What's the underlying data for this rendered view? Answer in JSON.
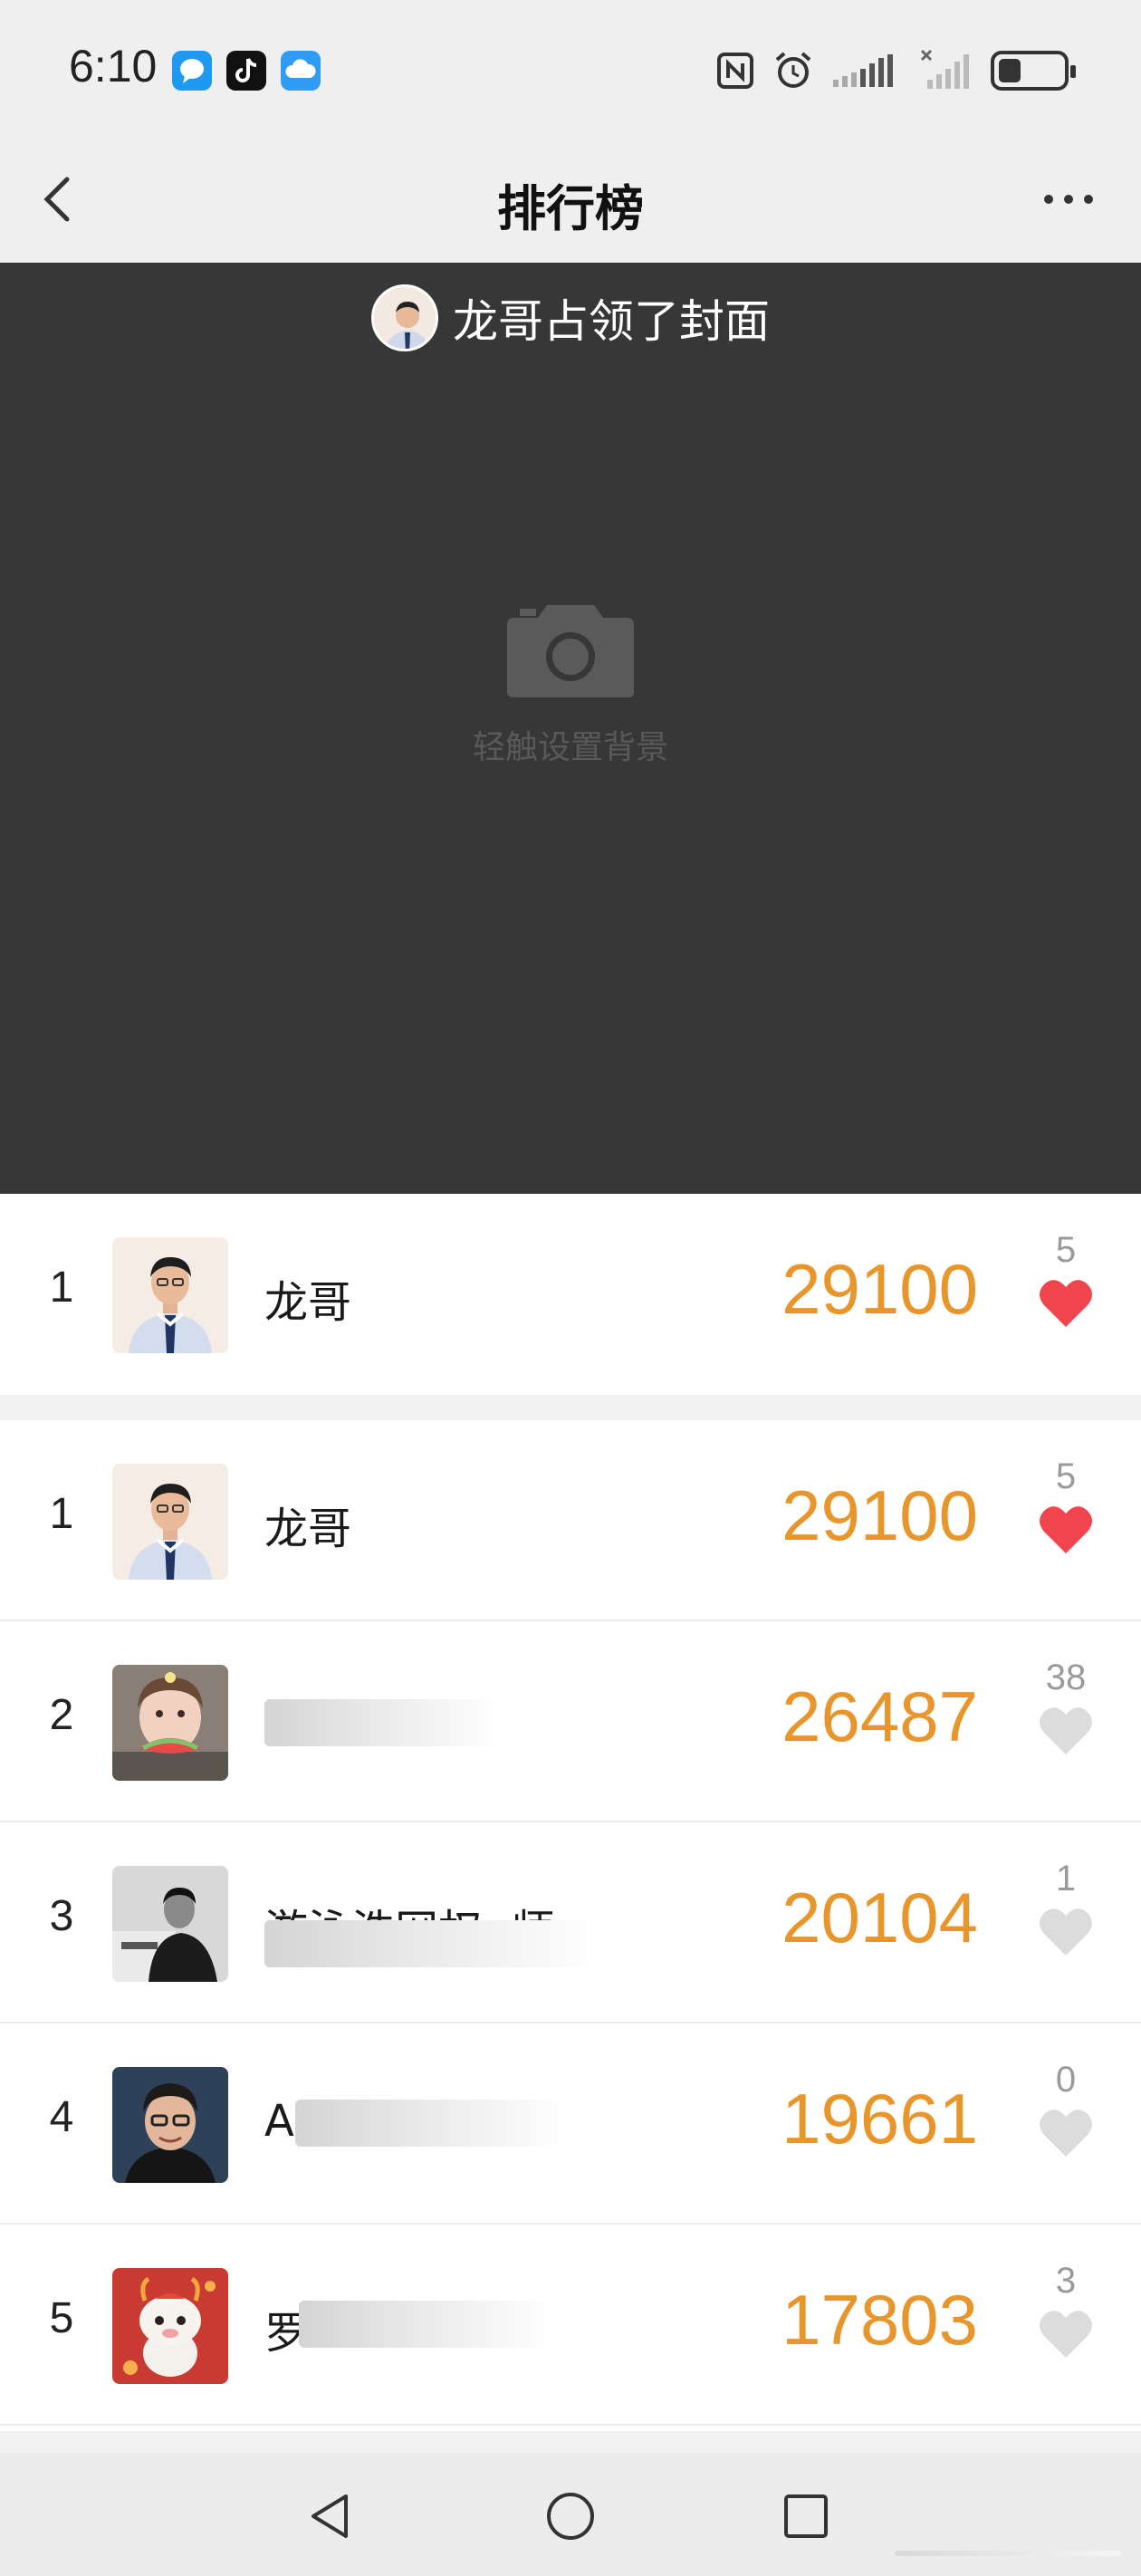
{
  "status_bar": {
    "time": "6:10",
    "apps": [
      "chat-bubble-app-icon",
      "tiktok-app-icon",
      "cloud-app-icon"
    ],
    "indicators": [
      "nfc-icon",
      "alarm-icon",
      "signal-icon",
      "signal-no-service-icon",
      "battery-icon"
    ],
    "battery_level": 0.35
  },
  "nav": {
    "title": "排行榜"
  },
  "cover": {
    "banner_text": "龙哥占领了封面",
    "hint": "轻触设置背景"
  },
  "my_rank": {
    "rank": "1",
    "name": "龙哥",
    "score": "29100",
    "likes": "5",
    "liked": true
  },
  "ranking": [
    {
      "rank": "1",
      "name": "龙哥",
      "score": "29100",
      "likes": "5",
      "liked": true
    },
    {
      "rank": "2",
      "name": "",
      "score": "26487",
      "likes": "38",
      "liked": false
    },
    {
      "rank": "3",
      "name": "游泳浩网权▪师",
      "score": "20104",
      "likes": "1",
      "liked": false
    },
    {
      "rank": "4",
      "name": "A",
      "score": "19661",
      "likes": "0",
      "liked": false
    },
    {
      "rank": "5",
      "name": "罗",
      "score": "17803",
      "likes": "3",
      "liked": false
    }
  ],
  "colors": {
    "score": "#e8962b",
    "heart_active": "#f0454d",
    "heart_inactive": "#dcdcdc",
    "cover_bg": "#373737"
  }
}
